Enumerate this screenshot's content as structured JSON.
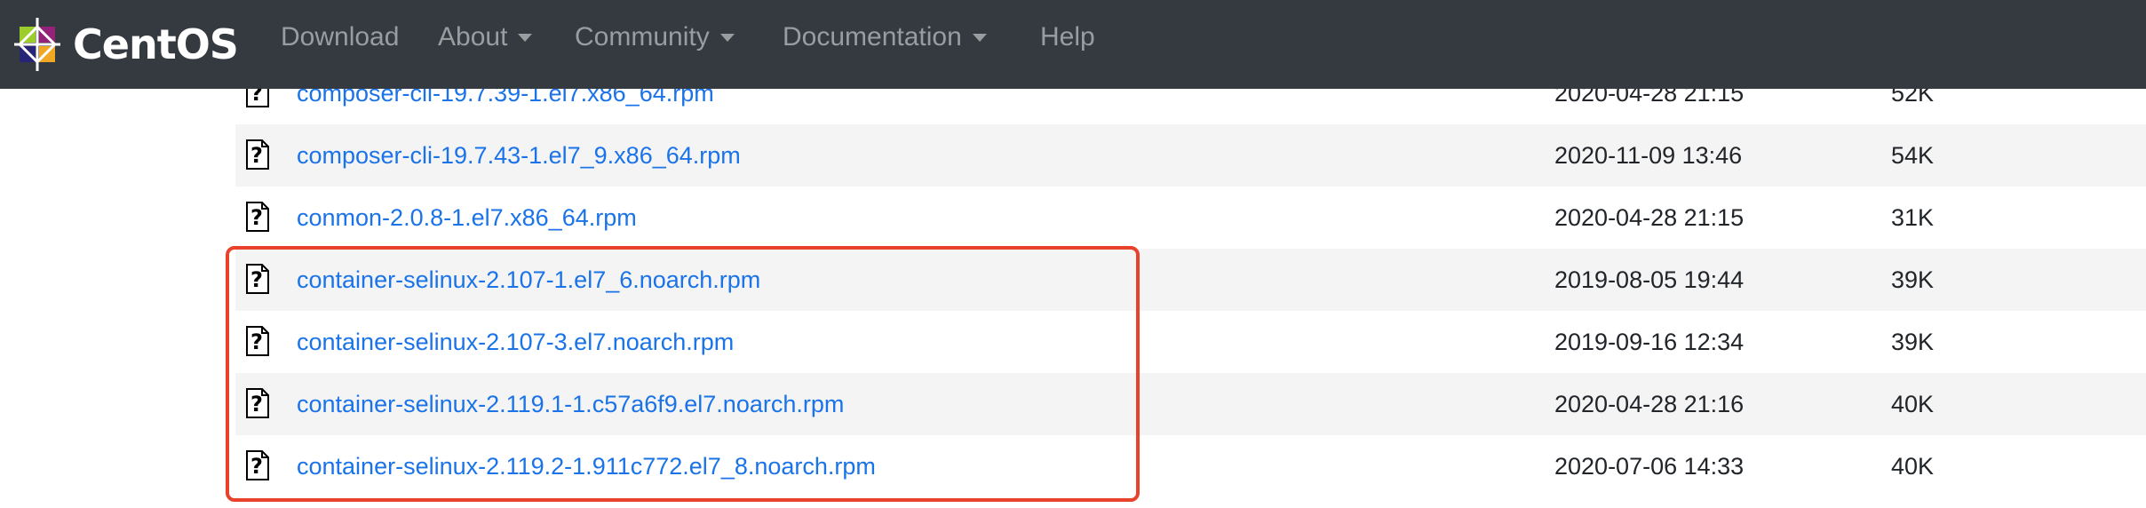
{
  "navbar": {
    "brand": "CentOS",
    "items": [
      {
        "label": "Download",
        "dropdown": false
      },
      {
        "label": "About",
        "dropdown": true
      },
      {
        "label": "Community",
        "dropdown": true
      },
      {
        "label": "Documentation",
        "dropdown": true
      },
      {
        "label": "Help",
        "dropdown": false
      }
    ]
  },
  "files": [
    {
      "name": "composer-cli-19.7.39-1.el7.x86_64.rpm",
      "date": "2020-04-28 21:15",
      "size": "52K",
      "icon": "unknown-file-icon"
    },
    {
      "name": "composer-cli-19.7.43-1.el7_9.x86_64.rpm",
      "date": "2020-11-09 13:46",
      "size": "54K",
      "icon": "unknown-file-icon"
    },
    {
      "name": "conmon-2.0.8-1.el7.x86_64.rpm",
      "date": "2020-04-28 21:15",
      "size": "31K",
      "icon": "unknown-file-icon"
    },
    {
      "name": "container-selinux-2.107-1.el7_6.noarch.rpm",
      "date": "2019-08-05 19:44",
      "size": "39K",
      "icon": "unknown-file-icon"
    },
    {
      "name": "container-selinux-2.107-3.el7.noarch.rpm",
      "date": "2019-09-16 12:34",
      "size": "39K",
      "icon": "unknown-file-icon"
    },
    {
      "name": "container-selinux-2.119.1-1.c57a6f9.el7.noarch.rpm",
      "date": "2020-04-28 21:16",
      "size": "40K",
      "icon": "unknown-file-icon"
    },
    {
      "name": "container-selinux-2.119.2-1.911c772.el7_8.noarch.rpm",
      "date": "2020-07-06 14:33",
      "size": "40K",
      "icon": "unknown-file-icon"
    }
  ],
  "colors": {
    "navbar": "#343a40",
    "link": "#1a73e8",
    "highlight": "#e8412c",
    "stripe": "#f4f4f4"
  }
}
